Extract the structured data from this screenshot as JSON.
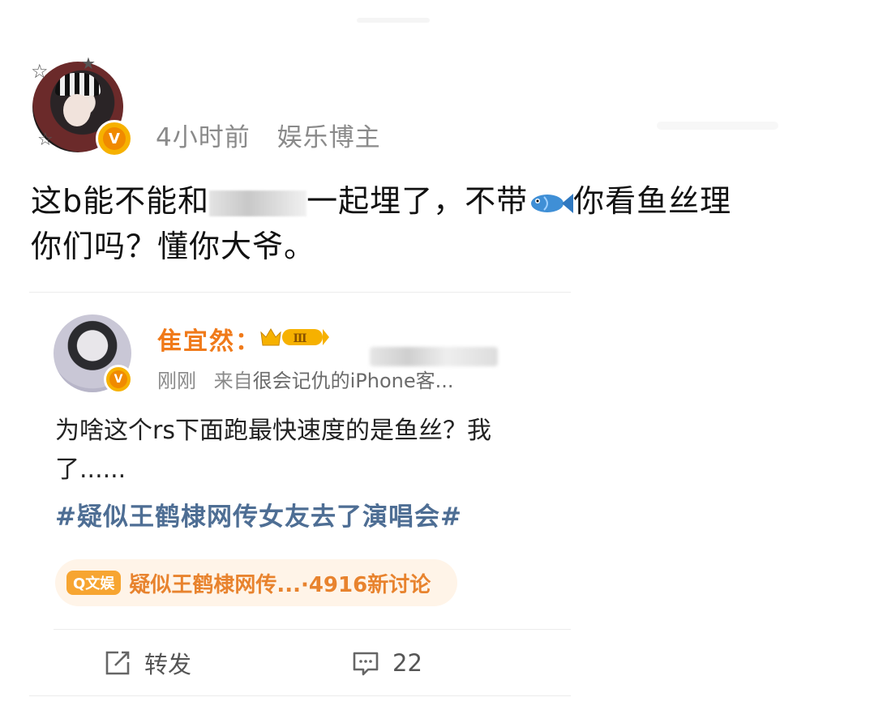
{
  "post": {
    "time": "4小时前",
    "category": "娱乐博主",
    "text_part1": "这b能不能和",
    "text_part2": "一起埋了，不带",
    "text_part3": "你看鱼丝理",
    "text_line2": "你们吗？懂你大爷。"
  },
  "retweet": {
    "username": "隹宜然：",
    "level_badge": "Ⅲ",
    "time": "刚刚",
    "source_prefix": "来自",
    "device": "很会记仇的iPhone客...",
    "text": "为啥这个rs下面跑最快速度的是鱼丝？我",
    "text_line2": "了......",
    "hashtag": "#疑似王鹤棣网传女友去了演唱会#",
    "topic": {
      "tag": "Q文娱",
      "title": "疑似王鹤棣网传...",
      "stats": "·4916新讨论"
    }
  },
  "actions": {
    "repost_label": "转发",
    "comment_count": "22"
  },
  "colors": {
    "username": "#f07a1a",
    "hashtag": "#4e6e94",
    "topic_bg": "#fff4e8",
    "topic_text": "#e8832e",
    "verified": "#f6b100"
  }
}
